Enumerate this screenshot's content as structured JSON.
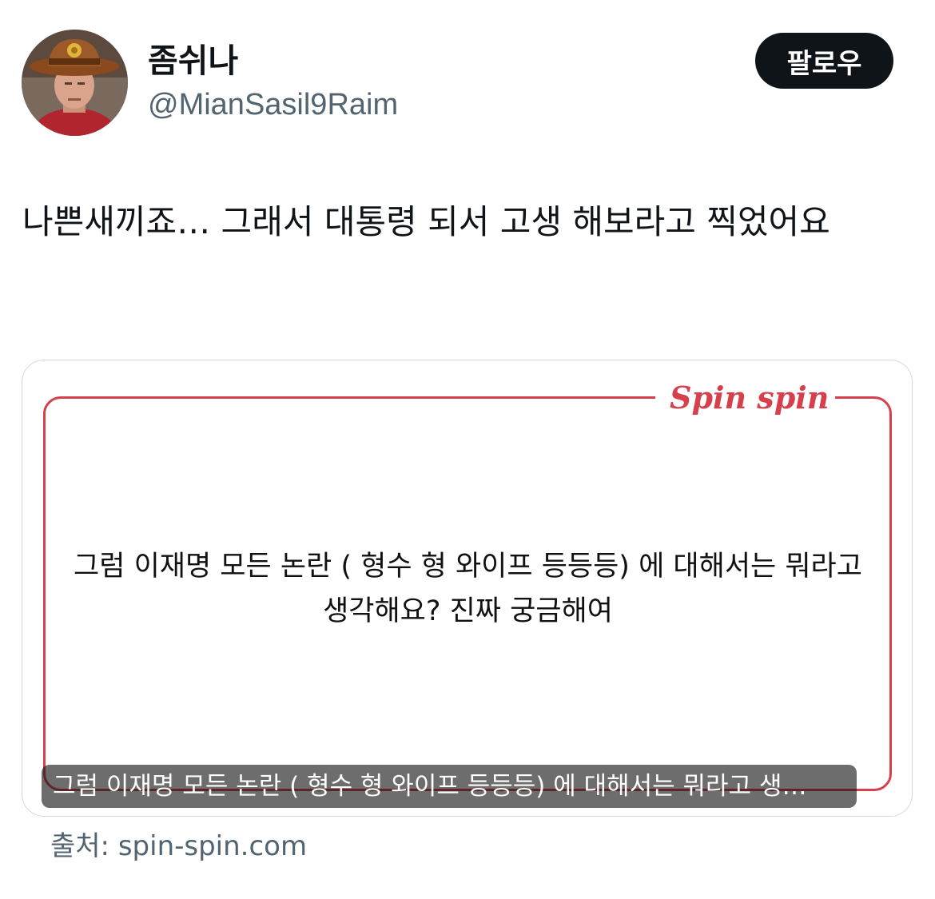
{
  "author": {
    "display_name": "좀쉬나",
    "handle": "@MianSasil9Raim",
    "follow_label": "팔로우"
  },
  "tweet": {
    "text": "나쁜새끼죠… 그래서 대통령 되서 고생 해보라고 찍었어요"
  },
  "card": {
    "logo": "Spin spin",
    "question": "그럼 이재명 모든 논란 ( 형수 형 와이프 등등등) 에 대해서는 뭐라고 생각해요? 진짜 궁금해여",
    "caption": "그럼 이재명 모든 논란 ( 형수 형 와이프 등등등) 에 대해서는 뭐라고 생…",
    "accent_color": "#d6404d"
  },
  "source": {
    "text": "출처: spin-spin.com"
  }
}
